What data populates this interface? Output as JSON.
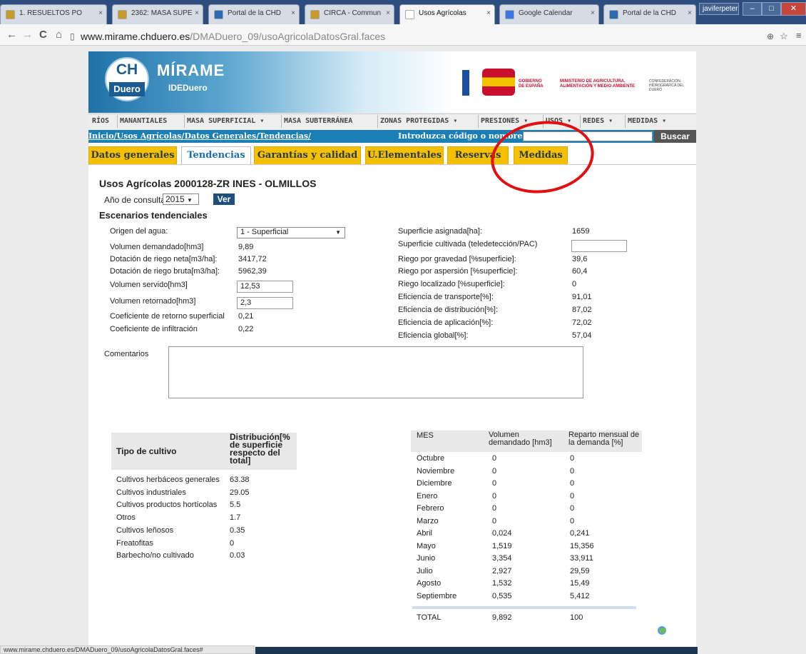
{
  "browser": {
    "tabs": [
      {
        "label": "1. RESUELTOS PO",
        "icon": "folder-icon",
        "color": "#c89a2a"
      },
      {
        "label": "2362: MASA SUPE",
        "icon": "folder-icon",
        "color": "#c89a2a"
      },
      {
        "label": "Portal de la CHD",
        "icon": "chd-icon",
        "color": "#2a6ab0"
      },
      {
        "label": "CIRCA - Commun",
        "icon": "circa-icon",
        "color": "#c89a2a"
      },
      {
        "label": "Usos Agrícolas",
        "icon": "page-icon",
        "color": "#ffffff"
      },
      {
        "label": "Google Calendar",
        "icon": "calendar-icon",
        "color": "#3b78e7"
      },
      {
        "label": "Portal de la CHD",
        "icon": "chd-icon",
        "color": "#2a6ab0"
      }
    ],
    "user": "javiferpeter",
    "url_host": "www.mirame.chduero.es",
    "url_path": "/DMADuero_09/usoAgricolaDatosGral.faces",
    "status_url": "www.mirame.chduero.es/DMADuero_09/usoAgricolaDatosGral.faces#"
  },
  "banner": {
    "ch": "CH",
    "duero": "Duero",
    "mirame": "MÍRAME",
    "idedu": "IDEDuero",
    "gobierno": "GOBIERNO DE ESPAÑA",
    "ministerio": "MINISTERIO DE AGRICULTURA, ALIMENTACIÓN Y MEDIO AMBIENTE",
    "confederacion": "CONFEDERACIÓN HIDROGRÁFICA DEL DUERO"
  },
  "mainnav": [
    "RÍOS",
    "MANANTIALES",
    "MASA SUPERFICIAL ▾",
    "MASA SUBTERRÁNEA",
    "ZONAS PROTEGIDAS ▾",
    "PRESIONES ▾",
    "USOS ▾",
    "REDES ▾",
    "MEDIDAS ▾"
  ],
  "breadcrumb": "Inicio/Usos Agrícolas/Datos Generales/Tendencias/",
  "search": {
    "label": "Introduzca código o nombre:",
    "button": "Buscar"
  },
  "page_tabs": [
    "Datos generales",
    "Tendencias",
    "Garantías y calidad",
    "U.Elementales",
    "Reservas",
    "Medidas"
  ],
  "title": "Usos Agrícolas 2000128-ZR INES - OLMILLOS",
  "year": {
    "label": "Año de consulta:",
    "value": "2015",
    "button": "Ver"
  },
  "section": "Escenarios tendenciales",
  "left_fields": [
    {
      "label": "Origen del agua:",
      "value": "1 - Superficial"
    },
    {
      "label": "Volumen demandado[hm3]",
      "value": "9,89"
    },
    {
      "label": "Dotación de riego neta[m3/ha]:",
      "value": "3417,72"
    },
    {
      "label": "Dotación de riego bruta[m3/ha]:",
      "value": "5962,39"
    },
    {
      "label": "Volumen servido[hm3]",
      "value": "12,53"
    },
    {
      "label": "Volumen retornado[hm3]",
      "value": "2,3"
    },
    {
      "label": "Coeficiente de retorno superficial",
      "value": "0,21"
    },
    {
      "label": "Coeficiente de infiltración",
      "value": "0,22"
    }
  ],
  "right_fields": [
    {
      "label": "Superficie asignada[ha]:",
      "value": "1659"
    },
    {
      "label": "Superficie cultivada (teledetección/PAC)",
      "value": ""
    },
    {
      "label": "Riego por gravedad [%superficie]:",
      "value": "39,6"
    },
    {
      "label": "Riego por aspersión [%superficie]:",
      "value": "60,4"
    },
    {
      "label": "Riego localizado [%superficie]:",
      "value": "0"
    },
    {
      "label": "Eficiencia de transporte[%]:",
      "value": "91,01"
    },
    {
      "label": "Eficiencia de distribución[%]:",
      "value": "87,02"
    },
    {
      "label": "Eficiencia de aplicación[%]:",
      "value": "72,02"
    },
    {
      "label": "Eficiencia global[%]:",
      "value": "57,04"
    }
  ],
  "comments_label": "Comentarios",
  "cultivo_table": {
    "headers": [
      "Tipo de cultivo",
      "Distribución[% de superficie respecto del total]"
    ],
    "rows": [
      [
        "Cultivos herbáceos generales",
        "63.38"
      ],
      [
        "Cultivos industriales",
        "29.05"
      ],
      [
        "Cultivos productos hortícolas",
        "5.5"
      ],
      [
        "Otros",
        "1.7"
      ],
      [
        "Cultivos leñosos",
        "0.35"
      ],
      [
        "Freatofitas",
        "0"
      ],
      [
        "Barbecho/no cultivado",
        "0.03"
      ]
    ]
  },
  "mes_table": {
    "headers": [
      "MES",
      "Volumen demandado [hm3]",
      "Reparto mensual de la demanda [%]"
    ],
    "rows": [
      [
        "Octubre",
        "0",
        "0"
      ],
      [
        "Noviembre",
        "0",
        "0"
      ],
      [
        "Diciembre",
        "0",
        "0"
      ],
      [
        "Enero",
        "0",
        "0"
      ],
      [
        "Febrero",
        "0",
        "0"
      ],
      [
        "Marzo",
        "0",
        "0"
      ],
      [
        "Abril",
        "0,024",
        "0,241"
      ],
      [
        "Mayo",
        "1,519",
        "15,356"
      ],
      [
        "Junio",
        "3,354",
        "33,911"
      ],
      [
        "Julio",
        "2,927",
        "29,59"
      ],
      [
        "Agosto",
        "1,532",
        "15,49"
      ],
      [
        "Septiembre",
        "0,535",
        "5,412"
      ]
    ],
    "total": [
      "TOTAL",
      "9,892",
      "100"
    ]
  }
}
